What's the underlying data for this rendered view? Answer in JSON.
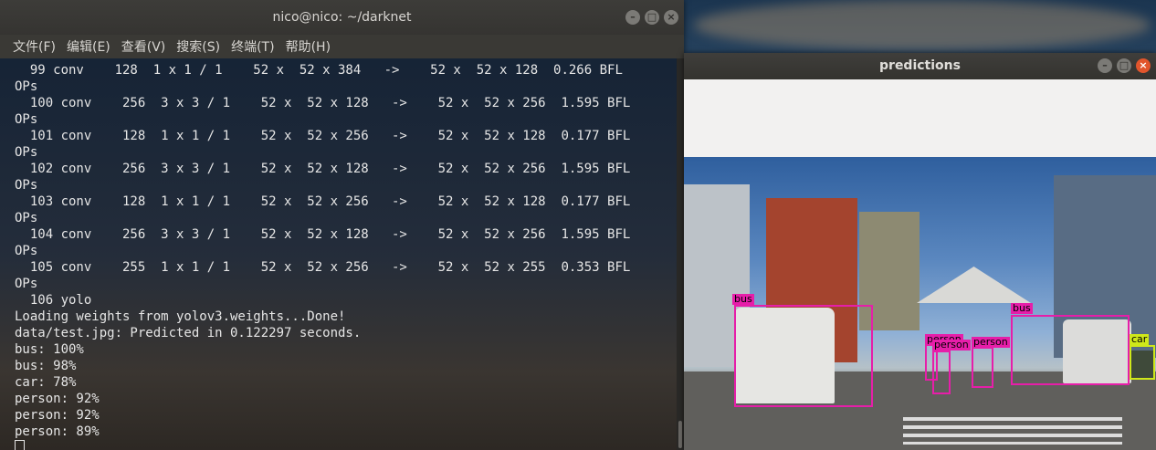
{
  "terminal": {
    "title": "nico@nico: ~/darknet",
    "menu": [
      "文件(F)",
      "编辑(E)",
      "查看(V)",
      "搜索(S)",
      "终端(T)",
      "帮助(H)"
    ],
    "lines": [
      "  99 conv    128  1 x 1 / 1    52 x  52 x 384   ->    52 x  52 x 128  0.266 BFL",
      "OPs",
      "  100 conv    256  3 x 3 / 1    52 x  52 x 128   ->    52 x  52 x 256  1.595 BFL",
      "OPs",
      "  101 conv    128  1 x 1 / 1    52 x  52 x 256   ->    52 x  52 x 128  0.177 BFL",
      "OPs",
      "  102 conv    256  3 x 3 / 1    52 x  52 x 128   ->    52 x  52 x 256  1.595 BFL",
      "OPs",
      "  103 conv    128  1 x 1 / 1    52 x  52 x 256   ->    52 x  52 x 128  0.177 BFL",
      "OPs",
      "  104 conv    256  3 x 3 / 1    52 x  52 x 128   ->    52 x  52 x 256  1.595 BFL",
      "OPs",
      "  105 conv    255  1 x 1 / 1    52 x  52 x 256   ->    52 x  52 x 255  0.353 BFL",
      "OPs",
      "  106 yolo",
      "Loading weights from yolov3.weights...Done!",
      "data/test.jpg: Predicted in 0.122297 seconds.",
      "bus: 100%",
      "bus: 98%",
      "car: 78%",
      "person: 92%",
      "person: 92%",
      "person: 89%"
    ],
    "window_buttons": {
      "minimize": "–",
      "maximize": "□",
      "close": "×"
    }
  },
  "predictions": {
    "title": "predictions",
    "window_buttons": {
      "minimize": "–",
      "maximize": "□",
      "close": "×"
    },
    "detections": [
      {
        "label": "bus"
      },
      {
        "label": "bus"
      },
      {
        "label": "person"
      },
      {
        "label": "person"
      },
      {
        "label": "person"
      },
      {
        "label": "car"
      }
    ],
    "colors": {
      "box": "#e61ea9",
      "car_box": "#cfe81a"
    }
  }
}
